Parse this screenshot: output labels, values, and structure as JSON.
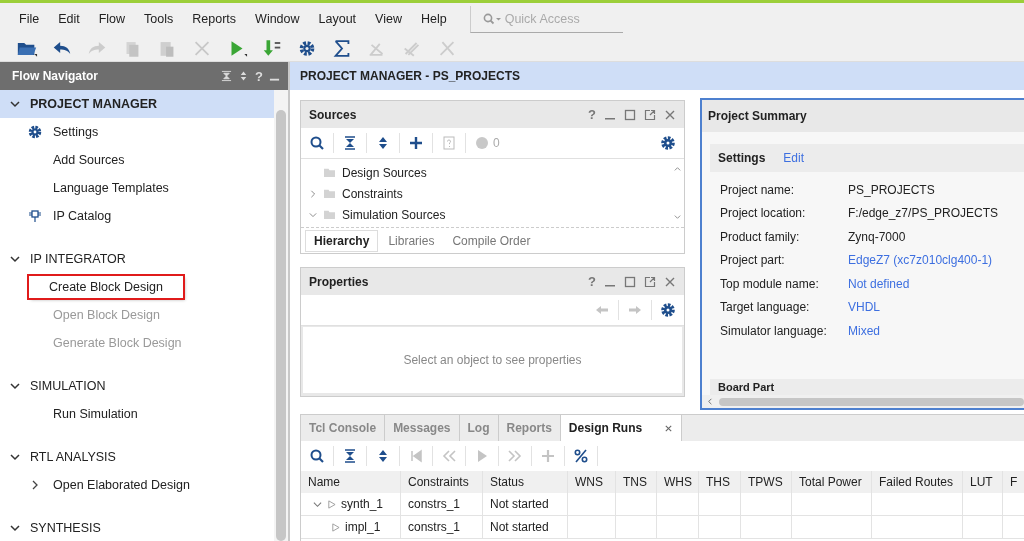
{
  "menu": [
    {
      "label": "File"
    },
    {
      "label": "Edit"
    },
    {
      "label": "Flow"
    },
    {
      "label": "Tools"
    },
    {
      "label": "Reports"
    },
    {
      "label": "Window"
    },
    {
      "label": "Layout"
    },
    {
      "label": "View"
    },
    {
      "label": "Help"
    }
  ],
  "quick_access": {
    "placeholder": "Quick Access"
  },
  "flow_navigator": {
    "title": "Flow Navigator",
    "help": "?",
    "sections": [
      {
        "title": "PROJECT MANAGER",
        "expanded": true,
        "selected": true,
        "items": [
          {
            "label": "Settings",
            "kind": "settings",
            "disabled": false,
            "highlighted": false
          },
          {
            "label": "Add Sources",
            "kind": "action",
            "disabled": false,
            "highlighted": false
          },
          {
            "label": "Language Templates",
            "kind": "action",
            "disabled": false,
            "highlighted": false
          },
          {
            "label": "IP Catalog",
            "kind": "catalog",
            "disabled": false,
            "highlighted": false
          }
        ]
      },
      {
        "title": "IP INTEGRATOR",
        "expanded": true,
        "selected": false,
        "items": [
          {
            "label": "Create Block Design",
            "kind": "action",
            "disabled": false,
            "highlighted": true
          },
          {
            "label": "Open Block Design",
            "kind": "action",
            "disabled": true,
            "highlighted": false
          },
          {
            "label": "Generate Block Design",
            "kind": "action",
            "disabled": true,
            "highlighted": false
          }
        ]
      },
      {
        "title": "SIMULATION",
        "expanded": true,
        "selected": false,
        "items": [
          {
            "label": "Run Simulation",
            "kind": "action",
            "disabled": false,
            "highlighted": false
          }
        ]
      },
      {
        "title": "RTL ANALYSIS",
        "expanded": true,
        "selected": false,
        "items": [
          {
            "label": "Open Elaborated Design",
            "kind": "expandable",
            "disabled": false,
            "highlighted": false
          }
        ]
      },
      {
        "title": "SYNTHESIS",
        "expanded": true,
        "selected": false
      }
    ]
  },
  "header": {
    "title": "PROJECT MANAGER - PS_PROJECTS"
  },
  "sources": {
    "title": "Sources",
    "help": "?",
    "count": "0",
    "tree": [
      {
        "label": "Design Sources",
        "expandable": false
      },
      {
        "label": "Constraints",
        "expandable": true,
        "expanded": false
      },
      {
        "label": "Simulation Sources",
        "expandable": true,
        "expanded": true
      }
    ],
    "tabs": [
      {
        "label": "Hierarchy",
        "selected": true
      },
      {
        "label": "Libraries",
        "selected": false
      },
      {
        "label": "Compile Order",
        "selected": false
      }
    ]
  },
  "properties": {
    "title": "Properties",
    "help": "?",
    "message": "Select an object to see properties"
  },
  "project_summary": {
    "title": "Project Summary",
    "section": "Settings",
    "edit_link": "Edit",
    "rows": [
      {
        "label": "Project name:",
        "value": "PS_PROJECTS",
        "link": false
      },
      {
        "label": "Project location:",
        "value": "F:/edge_z7/PS_PROJECTS",
        "link": false
      },
      {
        "label": "Product family:",
        "value": "Zynq-7000",
        "link": false
      },
      {
        "label": "Project part:",
        "value": "EdgeZ7 (xc7z010clg400-1)",
        "link": true
      },
      {
        "label": "Top module name:",
        "value": "Not defined",
        "link": true
      },
      {
        "label": "Target language:",
        "value": "VHDL",
        "link": true
      },
      {
        "label": "Simulator language:",
        "value": "Mixed",
        "link": true
      }
    ],
    "next_section": "Board Part"
  },
  "bottom": {
    "tabs": [
      {
        "label": "Tcl Console",
        "selected": false
      },
      {
        "label": "Messages",
        "selected": false
      },
      {
        "label": "Log",
        "selected": false
      },
      {
        "label": "Reports",
        "selected": false
      },
      {
        "label": "Design Runs",
        "selected": true
      }
    ],
    "columns": [
      "Name",
      "Constraints",
      "Status",
      "WNS",
      "TNS",
      "WHS",
      "THS",
      "TPWS",
      "Total Power",
      "Failed Routes",
      "LUT",
      "F"
    ],
    "rows": [
      {
        "name": "synth_1",
        "constraints": "constrs_1",
        "status": "Not started",
        "expanded": true,
        "children": [
          {
            "name": "impl_1",
            "constraints": "constrs_1",
            "status": "Not started"
          }
        ]
      }
    ]
  }
}
